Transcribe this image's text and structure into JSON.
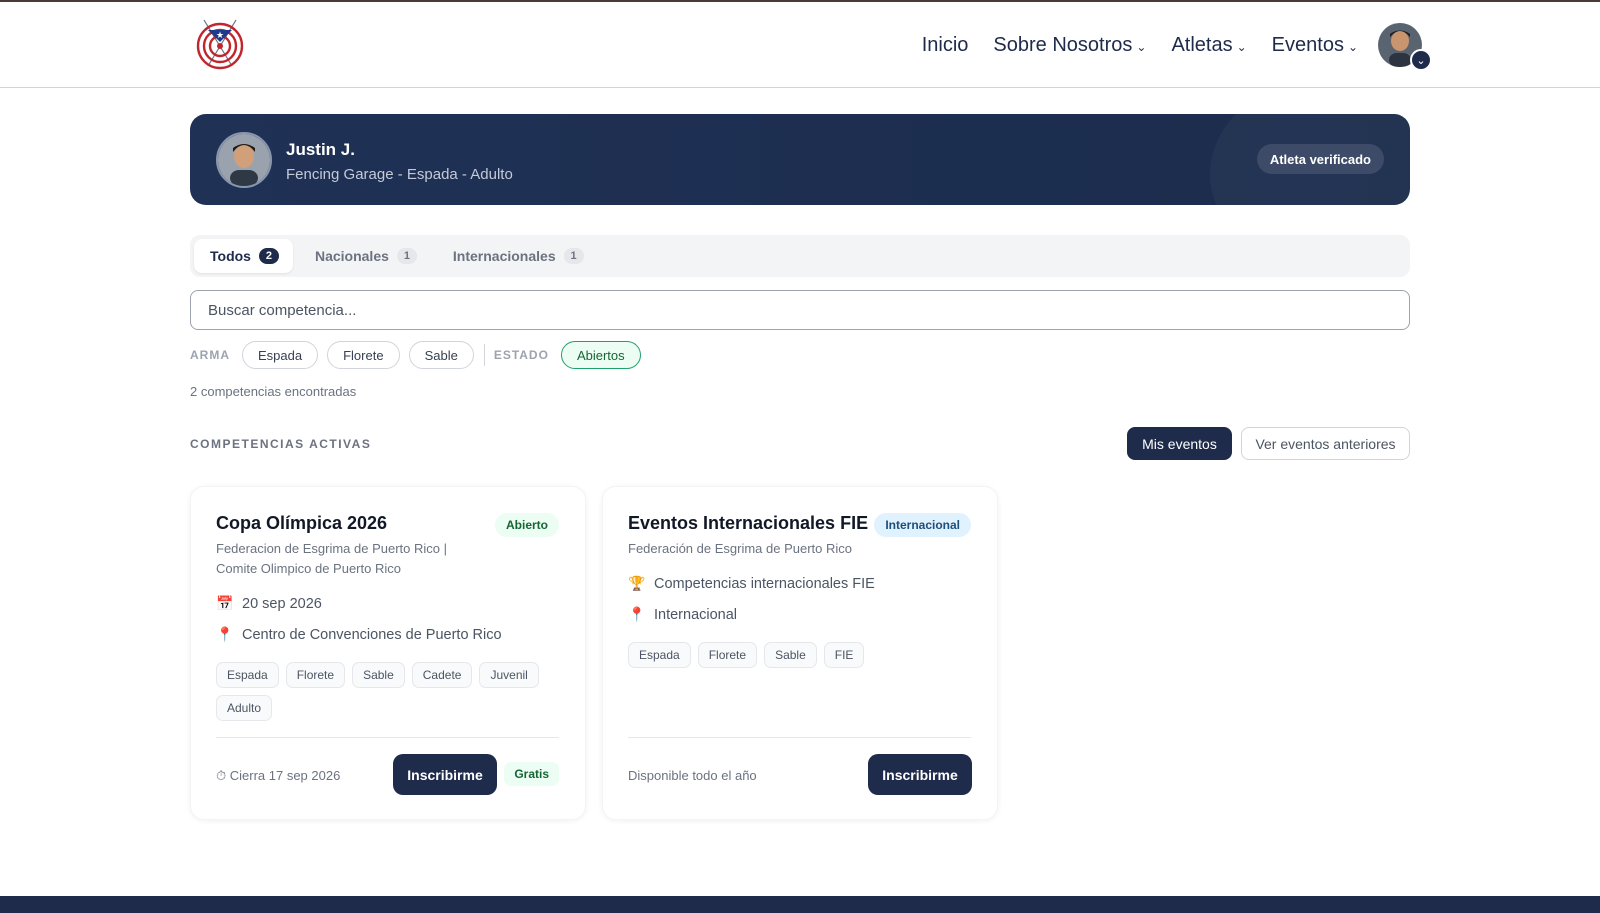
{
  "nav": {
    "items": [
      {
        "label": "Inicio",
        "dropdown": false
      },
      {
        "label": "Sobre Nosotros",
        "dropdown": true
      },
      {
        "label": "Atletas",
        "dropdown": true
      },
      {
        "label": "Eventos",
        "dropdown": true
      }
    ]
  },
  "profile": {
    "name": "Justin J.",
    "subtitle": "Fencing Garage - Espada - Adulto",
    "status_badge": "Atleta verificado"
  },
  "tabs": [
    {
      "label": "Todos",
      "count": "2",
      "active": true
    },
    {
      "label": "Nacionales",
      "count": "1",
      "active": false
    },
    {
      "label": "Internacionales",
      "count": "1",
      "active": false
    }
  ],
  "search": {
    "placeholder": "Buscar competencia..."
  },
  "filters": {
    "weapon_label": "ARMA",
    "weapons": [
      "Espada",
      "Florete",
      "Sable"
    ],
    "status_label": "ESTADO",
    "status_options": [
      "Abiertos"
    ],
    "status_selected": "Abiertos"
  },
  "results_count": "2 competencias encontradas",
  "section": {
    "title": "COMPETENCIAS ACTIVAS",
    "my_events_button": "Mis eventos",
    "past_events_button": "Ver eventos anteriores"
  },
  "competitions": [
    {
      "title": "Copa Olímpica 2026",
      "badge": "Abierto",
      "organizer": "Federacion de Esgrima de Puerto Rico | Comite Olimpico de Puerto Rico",
      "date_icon": "calendar-icon",
      "date": "20 sep 2026",
      "location_icon": "pin-icon",
      "location": "Centro de Convenciones de Puerto Rico",
      "tags": [
        "Espada",
        "Florete",
        "Sable",
        "Cadete",
        "Juvenil",
        "Adulto"
      ],
      "footer_note": "⏱ Cierra 17 sep 2026",
      "button": "Inscribirme",
      "price": "Gratis"
    },
    {
      "title": "Eventos Internacionales FIE",
      "badge": "Internacional",
      "organizer": "Federación de Esgrima de Puerto Rico",
      "date_icon": "trophy-icon",
      "date": "Competencias internacionales FIE",
      "location_icon": "pin-icon",
      "location": "Internacional",
      "tags": [
        "Espada",
        "Florete",
        "Sable",
        "FIE"
      ],
      "footer_note": "Disponible todo el año",
      "button": "Inscribirme"
    }
  ],
  "colors": {
    "primary": "#1e2b4a",
    "open_green": "#166534",
    "intl_blue": "#1e4e7a"
  }
}
